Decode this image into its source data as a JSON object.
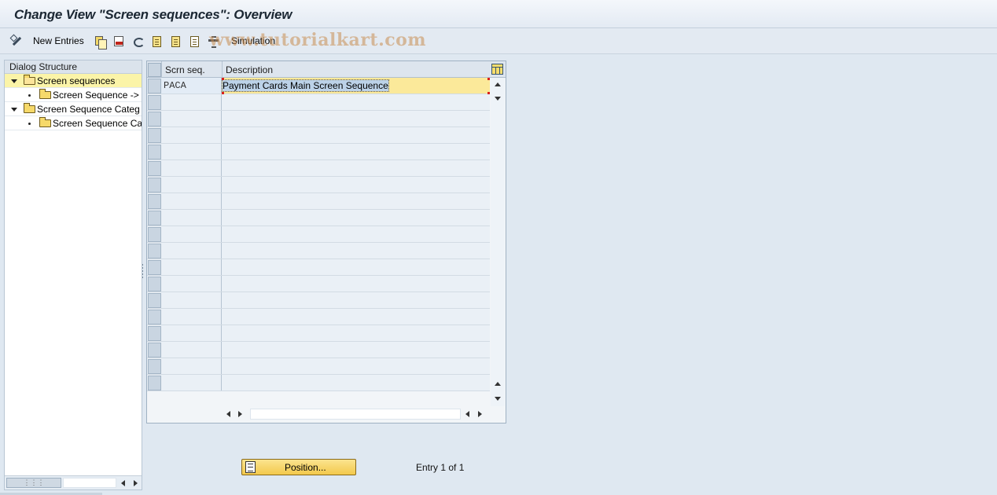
{
  "window": {
    "title": "Change View \"Screen sequences\": Overview"
  },
  "toolbar": {
    "new_entries": "New Entries",
    "simulation": "Simulation",
    "icons": [
      "edit-pen-icon",
      "copy-icon",
      "delete-icon",
      "undo-icon",
      "select-all-icon",
      "select-block-icon",
      "deselect-all-icon",
      "navigate-icon"
    ]
  },
  "watermark": "www.tutorialkart.com",
  "dialog_structure": {
    "header": "Dialog Structure",
    "items": [
      {
        "label": "Screen sequences",
        "level": 0,
        "expanded": true,
        "selected": true
      },
      {
        "label": "Screen Sequence ->",
        "level": 1
      },
      {
        "label": "Screen Sequence Categ",
        "level": 0,
        "expanded": true
      },
      {
        "label": "Screen Sequence Ca",
        "level": 1
      }
    ]
  },
  "table": {
    "columns": [
      "Scrn seq.",
      "Description"
    ],
    "rows": [
      {
        "scrn_seq": "PACA",
        "description": "Payment Cards Main Screen Sequence"
      }
    ],
    "visible_row_count": 19
  },
  "footer": {
    "position_button": "Position...",
    "entry_info": "Entry 1 of 1"
  },
  "colors": {
    "background": "#dfe8f1",
    "selection": "#fbf4a8",
    "button": "#f3c94c",
    "edit_cell": "#fbe99a"
  }
}
